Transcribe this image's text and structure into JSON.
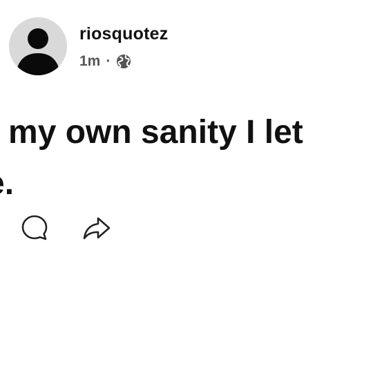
{
  "post": {
    "author": {
      "username": "riosquotez",
      "avatar_icon": "default-avatar-icon"
    },
    "time": "1m",
    "separator": "·",
    "visibility_icon": "globe-icon",
    "text": "r my own sanity I let\ne.",
    "actions": [
      {
        "name": "comment",
        "icon": "comment-bubble-icon"
      },
      {
        "name": "share",
        "icon": "share-arrow-icon"
      }
    ]
  },
  "colors": {
    "text": "#111111",
    "meta": "#555555",
    "avatar_bg": "#d9d9d9",
    "avatar_figure": "#0a0a0a"
  }
}
